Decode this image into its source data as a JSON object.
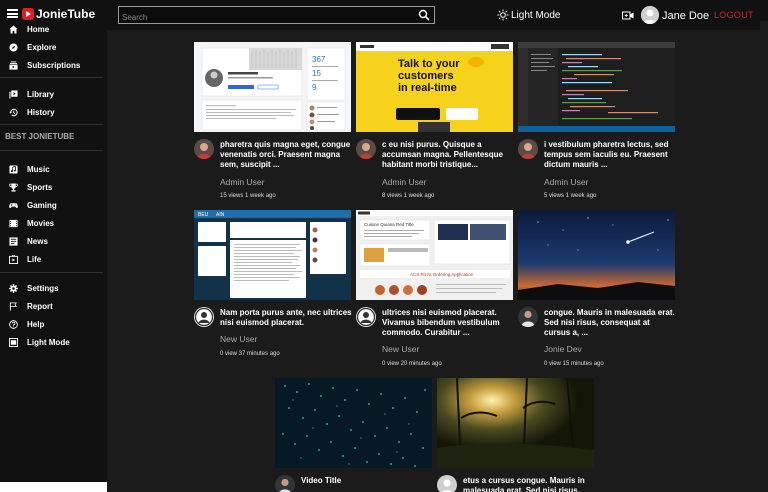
{
  "header": {
    "logo_text": "JonieTube",
    "search_placeholder": "Search",
    "light_mode_label": "Light Mode",
    "user_name": "Jane Doe",
    "logout_label": "LOGOUT"
  },
  "sidebar": {
    "primary": [
      {
        "label": "Home",
        "icon": "home-icon"
      },
      {
        "label": "Explore",
        "icon": "compass-icon"
      },
      {
        "label": "Subscriptions",
        "icon": "subscriptions-icon"
      }
    ],
    "library": [
      {
        "label": "Library",
        "icon": "library-icon"
      },
      {
        "label": "History",
        "icon": "history-icon"
      }
    ],
    "section_title": "BEST JONIETUBE",
    "categories": [
      {
        "label": "Music",
        "icon": "music-icon"
      },
      {
        "label": "Sports",
        "icon": "trophy-icon"
      },
      {
        "label": "Gaming",
        "icon": "gamepad-icon"
      },
      {
        "label": "Movies",
        "icon": "film-icon"
      },
      {
        "label": "News",
        "icon": "news-icon"
      },
      {
        "label": "Life",
        "icon": "live-icon"
      }
    ],
    "footer": [
      {
        "label": "Settings",
        "icon": "gear-icon"
      },
      {
        "label": "Report",
        "icon": "flag-icon"
      },
      {
        "label": "Help",
        "icon": "help-icon"
      },
      {
        "label": "Light Mode",
        "icon": "light-mode-icon"
      }
    ]
  },
  "videos": [
    {
      "title": "pharetra quis magna eget, congue venenatis orci. Praesent magna sem, suscipit ...",
      "channel": "Admin User",
      "meta": "15 views 1 week ago"
    },
    {
      "title": "c eu nisi purus. Quisque a accumsan magna. Pellentesque habitant morbi tristique...",
      "channel": "Admin User",
      "meta": "8 views 1 week ago"
    },
    {
      "title": "i vestibulum pharetra lectus, sed tempus sem iaculis eu. Praesent dictum mauris ...",
      "channel": "Admin User",
      "meta": "5 views 1 week ago"
    },
    {
      "title": "Nam porta purus ante, nec ultrices nisi euismod placerat.",
      "channel": "New User",
      "meta": "0 view 37 minutes ago"
    },
    {
      "title": "ultrices nisi euismod placerat. Vivamus bibendum vestibulum commodo. Curabitur ...",
      "channel": "New User",
      "meta": "0 view 20 minutes ago"
    },
    {
      "title": "congue. Mauris in malesuada erat. Sed nisi risus, consequat at cursus a, ...",
      "channel": "Jonie Dev",
      "meta": "0 view 15 minutes ago"
    },
    {
      "title": "Video Title",
      "channel": "",
      "meta": ""
    },
    {
      "title": "etus a cursus congue. Mauris in malesuada erat. Sed nisi risus,",
      "channel": "",
      "meta": ""
    }
  ],
  "thumb_texts": {
    "promo_line1": "Talk to your",
    "promo_line2": "customers",
    "promo_line3": "in real-time",
    "doc_title": "Cuisine Quiana Red Title",
    "doc_banner": "ACS Pizza Ordering Application",
    "social_tab1": "BEU",
    "social_tab2": "AIN"
  },
  "colors": {
    "accent_red": "#e01b24",
    "background": "#1b1b1b",
    "sidebar": "#111111"
  }
}
